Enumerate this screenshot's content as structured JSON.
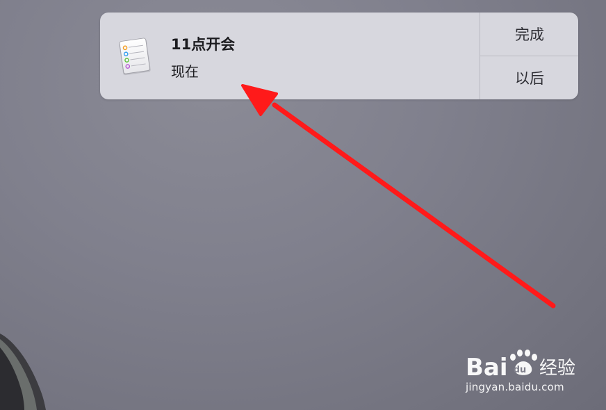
{
  "notification": {
    "app_icon": "reminders-list-icon",
    "title": "11点开会",
    "subtitle": "现在",
    "actions": {
      "done_label": "完成",
      "later_label": "以后"
    }
  },
  "annotation": {
    "arrow_color": "#ff1a1a"
  },
  "watermark": {
    "brand_text": "Bai",
    "brand_text_suffix": "经验",
    "url": "jingyan.baidu.com"
  },
  "colors": {
    "desktop_background": "#80808d",
    "notification_background": "#d7d7de",
    "divider": "#b9b9c1"
  }
}
